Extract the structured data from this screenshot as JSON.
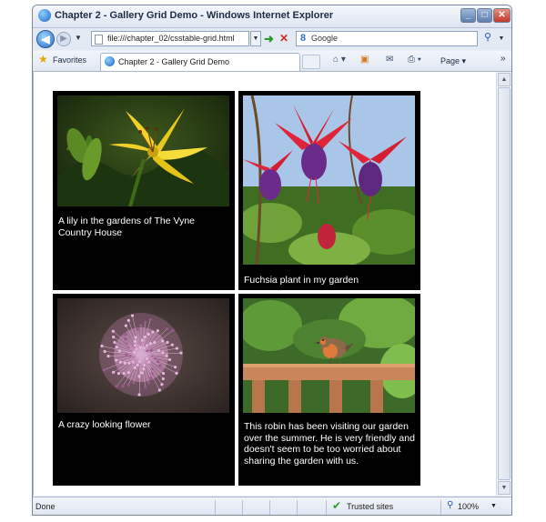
{
  "window": {
    "title": "Chapter 2 - Gallery Grid Demo - Windows Internet Explorer",
    "min_label": "_",
    "max_label": "□",
    "close_label": "✕"
  },
  "address_bar": {
    "back_glyph": "◀",
    "forward_glyph": "▶",
    "url": "file:///chapter_02/csstable-grid.html",
    "search_value": "Google",
    "search_logo": "8"
  },
  "favorites_bar": {
    "favorites_label": "Favorites",
    "tab_label": "Chapter 2 - Gallery Grid Demo",
    "page_menu": "Page ▾",
    "more": "»"
  },
  "gallery": [
    {
      "caption": "A lily in the gardens of The Vyne Country House",
      "image": "yellow-lily"
    },
    {
      "caption": "Fuchsia plant in my garden",
      "image": "fuchsia-flowers"
    },
    {
      "caption": "A crazy looking flower",
      "image": "allium-flower"
    },
    {
      "caption": "This robin has been visiting our garden over the summer. He is very friendly and doesn't seem to be too worried about sharing the garden with us.",
      "image": "robin-on-fence"
    }
  ],
  "status_bar": {
    "status": "Done",
    "zone": "Trusted sites",
    "zoom": "100%"
  },
  "colors": {
    "cell_background": "#000000",
    "caption_text": "#ffffff",
    "frame": "#ffffff"
  }
}
